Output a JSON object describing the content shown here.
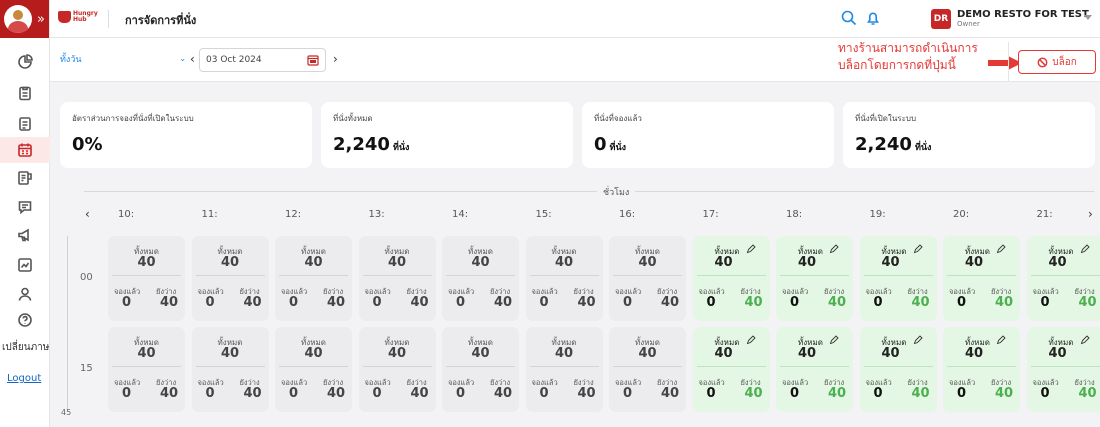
{
  "header": {
    "brand": "Hungry Hub",
    "page_title": "การจัดการที่นั่ง",
    "user": {
      "initials": "DR",
      "name": "DEMO RESTO FOR TEST",
      "role": "Owner"
    }
  },
  "sidebar": {
    "language_label": "เปลี่ยนภาษ",
    "logout_label": "Logout"
  },
  "filter": {
    "range": "ทั้งวัน",
    "date": "03 Oct 2024",
    "annotation": "ทางร้านสามารถดำเนินการบล็อกโดยการกดที่ปุ่มนี้",
    "block_button": "บล็อก"
  },
  "stats": [
    {
      "label": "อัตราส่วนการจองที่นั่งที่เปิดในระบบ",
      "value": "0%",
      "unit": ""
    },
    {
      "label": "ที่นั่งทั้งหมด",
      "value": "2,240",
      "unit": "ที่นั่ง"
    },
    {
      "label": "ที่นั่งที่จองแล้ว",
      "value": "0",
      "unit": "ที่นั่ง"
    },
    {
      "label": "ที่นั่งที่เปิดในระบบ",
      "value": "2,240",
      "unit": "ที่นั่ง"
    }
  ],
  "schedule": {
    "title": "ชั่วโมง",
    "hours": [
      "10:",
      "11:",
      "12:",
      "13:",
      "14:",
      "15:",
      "16:",
      "17:",
      "18:",
      "19:",
      "20:",
      "21:"
    ],
    "open_hours": [
      "17:",
      "18:",
      "19:",
      "20:",
      "21:"
    ],
    "minutes": [
      "00",
      "15"
    ],
    "next_minute_partial": "45",
    "labels": {
      "total": "ทั้งหมด",
      "booked": "จองแล้ว",
      "available": "ยังว่าง"
    },
    "slot_values": {
      "total": "40",
      "booked": "0",
      "available": "40"
    }
  }
}
